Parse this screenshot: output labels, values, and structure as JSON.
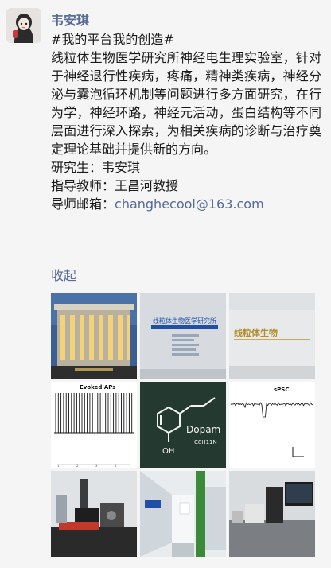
{
  "post": {
    "author": "韦安琪",
    "topic": "#我的平台我的创造#",
    "body": "线粒体生物医学研究所神经电生理实验室，针对于神经退行性疾病，疼痛，精神类疾病，神经分泌与囊泡循环机制等问题进行多方面研究，在行为学，神经环路，神经元活动，蛋白结构等不同层面进行深入探索，为相关疾病的诊断与治疗奠定理论基础并提供新的方向。",
    "student_label": "研究生：",
    "student_name": "韦安琪",
    "advisor_label": "指导教师：",
    "advisor_name": "王昌河教授",
    "email_label": "导师邮箱：",
    "email": "changhecool@163.com",
    "collapse": "收起"
  },
  "images": {
    "wall_sign_text": "线粒体生物医学研究所",
    "trace_1_title": "Evoked APs",
    "trace_2_title": "sPSC",
    "dopamine_text": "Dopam",
    "dopamine_formula": "C8H11N",
    "oh_label": "OH"
  }
}
